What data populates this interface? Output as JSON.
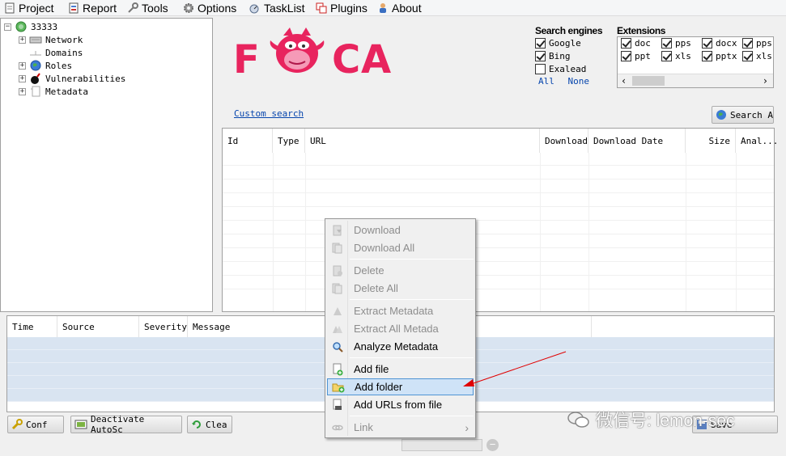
{
  "menubar": {
    "items": [
      {
        "label": "Project",
        "icon": "document-icon"
      },
      {
        "label": "Report",
        "icon": "report-icon"
      },
      {
        "label": "Tools",
        "icon": "tools-icon"
      },
      {
        "label": "Options",
        "icon": "gear-icon"
      },
      {
        "label": "TaskList",
        "icon": "tasklist-icon"
      },
      {
        "label": "Plugins",
        "icon": "plugins-icon"
      },
      {
        "label": "About",
        "icon": "about-icon"
      }
    ]
  },
  "tree": {
    "root": "33333",
    "children": [
      "Network",
      "Domains",
      "Roles",
      "Vulnerabilities",
      "Metadata"
    ]
  },
  "logo": {
    "letters": [
      "F",
      "C",
      "A"
    ],
    "color": "#e8245e"
  },
  "search_engines": {
    "title": "Search engines",
    "items": [
      {
        "label": "Google",
        "checked": true
      },
      {
        "label": "Bing",
        "checked": true
      },
      {
        "label": "Exalead",
        "checked": false
      }
    ],
    "all_label": "All",
    "none_label": "None"
  },
  "extensions": {
    "title": "Extensions",
    "row1": [
      "doc",
      "pps",
      "docx",
      "pps"
    ],
    "row2": [
      "ppt",
      "xls",
      "pptx",
      "xls"
    ]
  },
  "custom_search": "Custom search",
  "search_button": "Search A",
  "results": {
    "columns": [
      "Id",
      "Type",
      "URL",
      "Download",
      "Download Date",
      "Size",
      "Anal..."
    ]
  },
  "log": {
    "columns": [
      "Time",
      "Source",
      "Severity",
      "Message"
    ]
  },
  "bottom_buttons": {
    "conf": "Conf",
    "deactivate": "Deactivate AutoSc",
    "clear": "Clea",
    "save": "Save"
  },
  "context_menu": {
    "items": [
      {
        "label": "Download",
        "enabled": false,
        "icon": "download-icon"
      },
      {
        "label": "Download All",
        "enabled": false,
        "icon": "download-all-icon"
      },
      {
        "label": "Delete",
        "enabled": false,
        "icon": "delete-icon"
      },
      {
        "label": "Delete All",
        "enabled": false,
        "icon": "delete-all-icon"
      },
      {
        "label": "Extract Metadata",
        "enabled": false,
        "icon": "extract-metadata-icon"
      },
      {
        "label": "Extract All Metada",
        "enabled": false,
        "icon": "extract-all-metadata-icon"
      },
      {
        "label": "Analyze Metadata",
        "enabled": true,
        "icon": "magnifier-icon"
      },
      {
        "label": "Add file",
        "enabled": true,
        "icon": "add-file-icon"
      },
      {
        "label": "Add folder",
        "enabled": true,
        "icon": "add-folder-icon"
      },
      {
        "label": "Add URLs from file",
        "enabled": true,
        "icon": "add-urls-icon"
      },
      {
        "label": "Link",
        "enabled": false,
        "icon": "link-icon"
      }
    ],
    "submenu_arrow": "›"
  },
  "watermark": "微信号: lemon-sec",
  "annotation_color": "#e00000"
}
